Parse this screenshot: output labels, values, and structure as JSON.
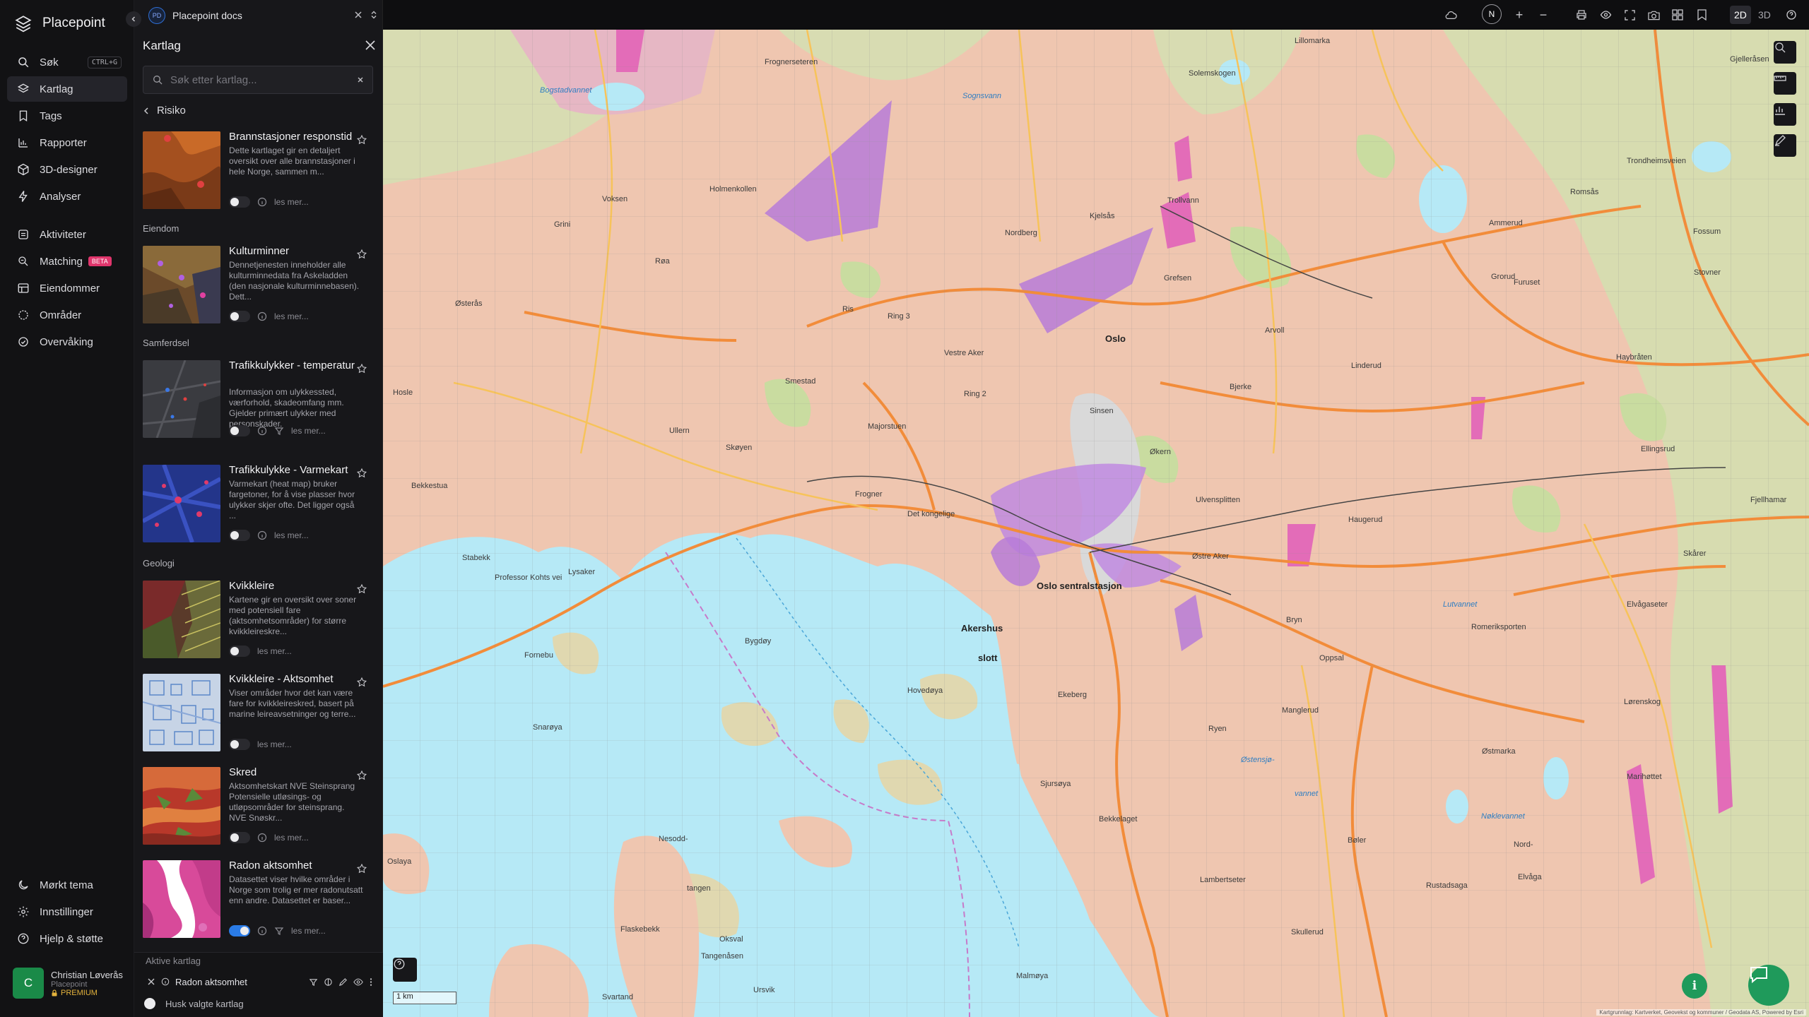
{
  "app": {
    "name": "Placepoint"
  },
  "nav": {
    "items": [
      {
        "label": "Søk",
        "shortcut": "CTRL+G",
        "icon": "search-icon"
      },
      {
        "label": "Kartlag",
        "icon": "layers-icon",
        "active": true
      },
      {
        "label": "Tags",
        "icon": "bookmark-icon"
      },
      {
        "label": "Rapporter",
        "icon": "chart-icon"
      },
      {
        "label": "3D-designer",
        "icon": "cube-icon"
      },
      {
        "label": "Analyser",
        "icon": "bolt-icon"
      },
      {
        "label": "Aktiviteter",
        "icon": "stack-icon"
      },
      {
        "label": "Matching",
        "badge": "BETA",
        "icon": "match-icon"
      },
      {
        "label": "Eiendommer",
        "icon": "table-icon"
      },
      {
        "label": "Områder",
        "icon": "area-icon"
      },
      {
        "label": "Overvåking",
        "icon": "monitor-icon"
      }
    ],
    "bottom": [
      {
        "label": "Mørkt tema",
        "icon": "moon-icon"
      },
      {
        "label": "Innstillinger",
        "icon": "gear-icon"
      },
      {
        "label": "Hjelp & støtte",
        "icon": "help-icon"
      }
    ],
    "user": {
      "initial": "C",
      "name": "Christian Løverås",
      "org": "Placepoint",
      "plan": "PREMIUM"
    }
  },
  "document": {
    "badge": "PD",
    "title": "Placepoint docs"
  },
  "panel": {
    "title": "Kartlag",
    "search_placeholder": "Søk etter kartlag...",
    "breadcrumb": "Risiko",
    "sections": {
      "eiendom": "Eiendom",
      "samferdsel": "Samferdsel",
      "geologi": "Geologi"
    },
    "read_more": "les mer...",
    "layers": [
      {
        "title": "Brannstasjoner responstid",
        "desc": "Dette kartlaget gir en detaljert oversikt over alle brannstasjoner i hele Norge, sammen m...",
        "on": false
      },
      {
        "title": "Kulturminner",
        "desc": "Dennetjenesten inneholder alle kulturminnedata fra Askeladden (den nasjonale kulturminnebasen). Dett...",
        "on": false
      },
      {
        "title": "Trafikkulykker - temperatur",
        "desc": "Informasjon om ulykkessted, værforhold, skadeomfang mm. Gjelder primært ulykker med personskader.",
        "on": false
      },
      {
        "title": "Trafikkulykke - Varmekart",
        "desc": "Varmekart (heat map) bruker fargetoner, for å vise plasser hvor ulykker skjer ofte. Det ligger også ...",
        "on": false
      },
      {
        "title": "Kvikkleire",
        "desc": "Kartene gir en oversikt over soner med potensiell fare (aktsomhetsområder) for større kvikkleireskre...",
        "on": false
      },
      {
        "title": "Kvikkleire - Aktsomhet",
        "desc": "Viser områder hvor det kan være fare for kvikkleireskred, basert på marine leireavsetninger og terre...",
        "on": false
      },
      {
        "title": "Skred",
        "desc": "Aktsomhetskart NVE Steinsprang Potensielle utløsings- og utløpsområder for steinsprang. NVE Snøskr...",
        "on": false
      },
      {
        "title": "Radon aktsomhet",
        "desc": "Datasettet viser hvilke områder i Norge som trolig er mer radonutsatt enn andre. Datasettet er baser...",
        "on": true
      }
    ],
    "active": {
      "label": "Aktive kartlag",
      "layer": "Radon aktsomhet",
      "remember": "Husk valgte kartlag"
    }
  },
  "topbar": {
    "compass": "N",
    "mode_2d": "2D",
    "mode_3d": "3D",
    "plus": "+",
    "minus": "−"
  },
  "map": {
    "scale": "1 km",
    "attribution": "Kartgrunnlag: Kartverket, Geovekst og kommuner / Geodata AS, Powered by Esri",
    "labels": [
      {
        "t": "Oslo",
        "c": "big"
      },
      {
        "t": "Oslo sentralstasjon",
        "c": "big"
      },
      {
        "t": "Akershus",
        "c": "big"
      },
      {
        "t": "slott",
        "c": "big"
      },
      {
        "t": "Frognerseteren"
      },
      {
        "t": "Holmenkollen"
      },
      {
        "t": "Vestre Aker"
      },
      {
        "t": "Majorstuen"
      },
      {
        "t": "Frogner"
      },
      {
        "t": "Det kongelige"
      },
      {
        "t": "Bygdøy"
      },
      {
        "t": "Grefsen"
      },
      {
        "t": "Nordberg"
      },
      {
        "t": "Kjelsås"
      },
      {
        "t": "Sinsen"
      },
      {
        "t": "Økern"
      },
      {
        "t": "Ulvensplitten"
      },
      {
        "t": "Haugerud"
      },
      {
        "t": "Østre Aker"
      },
      {
        "t": "Bryn"
      },
      {
        "t": "Oppsal"
      },
      {
        "t": "Ryen"
      },
      {
        "t": "Manglerud"
      },
      {
        "t": "Ekeberg"
      },
      {
        "t": "Sjursøya"
      },
      {
        "t": "Bekkelaget"
      },
      {
        "t": "Nesodd-"
      },
      {
        "t": "tangen"
      },
      {
        "t": "Oksval"
      },
      {
        "t": "Malmøya"
      },
      {
        "t": "Ursvik"
      },
      {
        "t": "Lambertseter"
      },
      {
        "t": "Skullerud"
      },
      {
        "t": "Rustadsaga"
      },
      {
        "t": "Bøler"
      },
      {
        "t": "Linderud"
      },
      {
        "t": "Arvoll"
      },
      {
        "t": "Bjerke"
      },
      {
        "t": "Ris"
      },
      {
        "t": "Røa"
      },
      {
        "t": "Ullern"
      },
      {
        "t": "Smestad"
      },
      {
        "t": "Skøyen"
      },
      {
        "t": "Lysaker"
      },
      {
        "t": "Stabekk"
      },
      {
        "t": "Bekkestua"
      },
      {
        "t": "Fornebu"
      },
      {
        "t": "Snarøya"
      },
      {
        "t": "Østerås"
      },
      {
        "t": "Hosle"
      },
      {
        "t": "Voksen"
      },
      {
        "t": "Grini"
      },
      {
        "t": "Fossum"
      },
      {
        "t": "Ammerud"
      },
      {
        "t": "Romsås"
      },
      {
        "t": "Gjelleråsen"
      },
      {
        "t": "Lillomarka"
      },
      {
        "t": "Solemskogen"
      },
      {
        "t": "Sognsvann",
        "c": "water"
      },
      {
        "t": "Bogstadvannet",
        "c": "water"
      },
      {
        "t": "Lutvannet",
        "c": "water"
      },
      {
        "t": "Nøklevannet",
        "c": "water"
      },
      {
        "t": "Østensjø-",
        "c": "water"
      },
      {
        "t": "vannet",
        "c": "water"
      },
      {
        "t": "Lørenskog"
      },
      {
        "t": "Hovedøya"
      },
      {
        "t": "Ring 3"
      },
      {
        "t": "Ring 2"
      },
      {
        "t": "Professor Kohts vei"
      },
      {
        "t": "Trondheimsveien"
      },
      {
        "t": "Romeriksporten"
      },
      {
        "t": "Fjellhamar"
      },
      {
        "t": "Haybråten"
      },
      {
        "t": "Stovner"
      },
      {
        "t": "Elvågaseter"
      },
      {
        "t": "Skårer"
      },
      {
        "t": "Ellingsrud"
      },
      {
        "t": "Furuset"
      },
      {
        "t": "Grorud"
      },
      {
        "t": "Trollvann"
      },
      {
        "t": "Østmarka"
      },
      {
        "t": "Marihøttet"
      },
      {
        "t": "Nord-"
      },
      {
        "t": "Elvåga"
      },
      {
        "t": "Flaskebekk"
      },
      {
        "t": "Tangenåsen"
      },
      {
        "t": "Svartand"
      },
      {
        "t": "Oslaya"
      }
    ]
  },
  "colors": {
    "accent": "#2a7be6",
    "green": "#1f9a5b",
    "beta": "#e0356c",
    "premium": "#e3b23c",
    "radon": "#b77bd8"
  }
}
